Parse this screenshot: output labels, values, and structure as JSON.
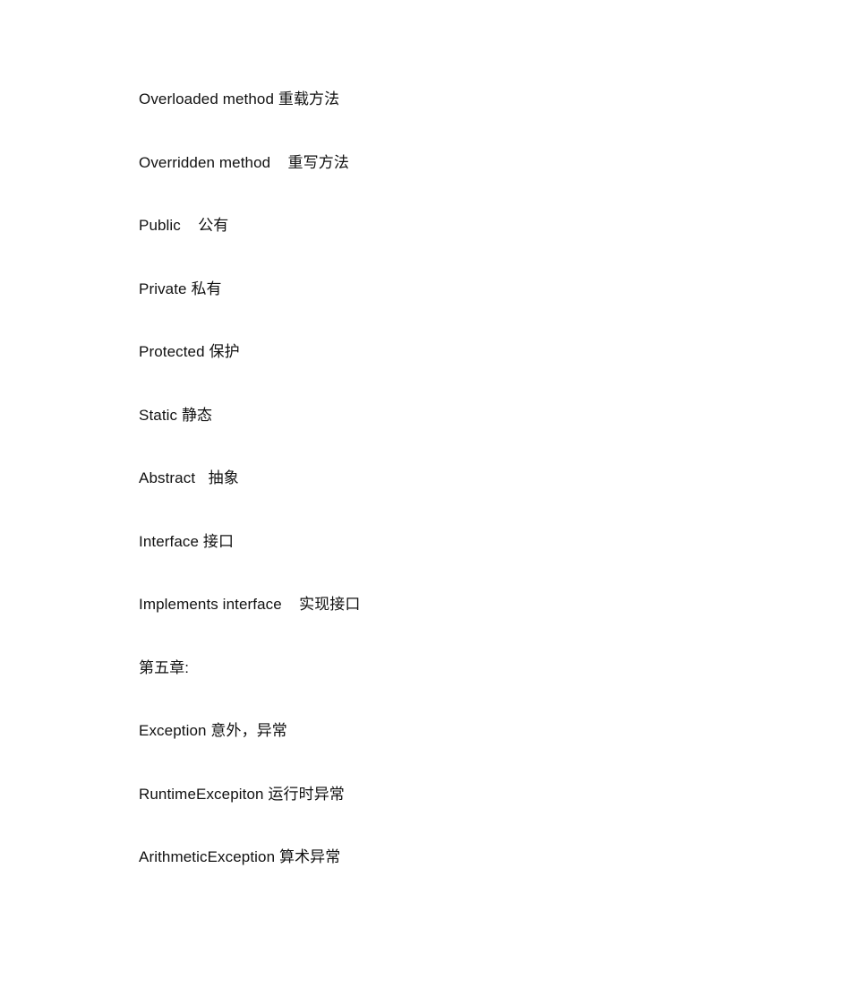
{
  "document": {
    "background_color": "#ffffff",
    "text_color": "#111111",
    "lines": [
      {
        "kind": "glossary",
        "term_en": "Overloaded method",
        "separator": " ",
        "term_zh": "重载方法"
      },
      {
        "kind": "glossary",
        "term_en": "Overridden method",
        "separator": "    ",
        "term_zh": "重写方法"
      },
      {
        "kind": "glossary",
        "term_en": "Public",
        "separator": "    ",
        "term_zh": "公有"
      },
      {
        "kind": "glossary",
        "term_en": "Private",
        "separator": " ",
        "term_zh": "私有"
      },
      {
        "kind": "glossary",
        "term_en": "Protected",
        "separator": " ",
        "term_zh": "保护"
      },
      {
        "kind": "glossary",
        "term_en": "Static",
        "separator": " ",
        "term_zh": "静态"
      },
      {
        "kind": "glossary",
        "term_en": "Abstract",
        "separator": "   ",
        "term_zh": "抽象"
      },
      {
        "kind": "glossary",
        "term_en": "Interface",
        "separator": " ",
        "term_zh": "接口"
      },
      {
        "kind": "glossary",
        "term_en": "Implements interface",
        "separator": "    ",
        "term_zh": "实现接口"
      },
      {
        "kind": "heading",
        "text": "第五章:"
      },
      {
        "kind": "glossary",
        "term_en": "Exception",
        "separator": " ",
        "term_zh": "意外，异常"
      },
      {
        "kind": "glossary",
        "term_en": "RuntimeExcepiton",
        "separator": " ",
        "term_zh": "运行时异常"
      },
      {
        "kind": "glossary",
        "term_en": "ArithmeticException",
        "separator": " ",
        "term_zh": "算术异常"
      }
    ]
  }
}
